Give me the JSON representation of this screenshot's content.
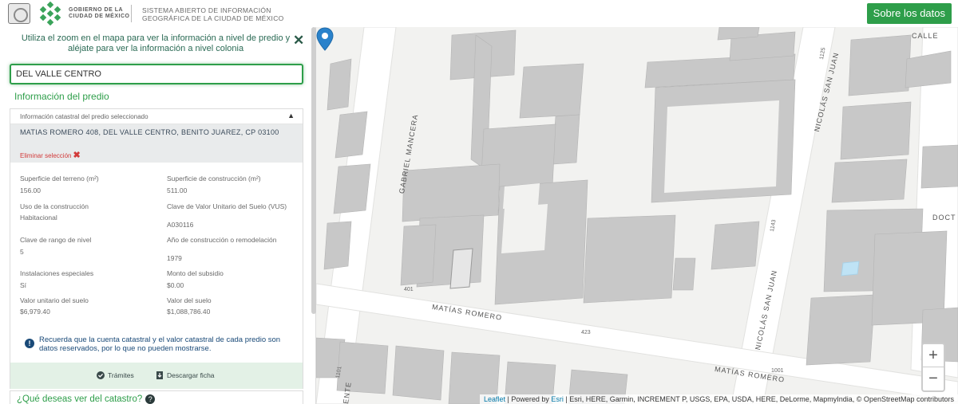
{
  "header": {
    "gov_line1": "GOBIERNO DE LA",
    "gov_line2": "CIUDAD DE MÉXICO",
    "system_line1": "SISTEMA ABIERTO DE INFORMACIÓN",
    "system_line2": "GEOGRÁFICA DE LA CIUDAD DE MÉXICO",
    "about_button": "Sobre los datos"
  },
  "panel": {
    "hint": "Utiliza el zoom en el mapa para ver la información a nivel de predio y aléjate para ver la información a nivel colonia",
    "search_value": "DEL VALLE CENTRO",
    "info_title": "Información del predio",
    "card_title": "Información catastral del predio seleccionado",
    "address": "MATIAS ROMERO 408, DEL VALLE CENTRO, BENITO JUAREZ, CP 03100",
    "remove_label": "Eliminar selección",
    "fields": {
      "superficie_terreno_label": "Superficie del terreno (m²)",
      "superficie_terreno_value": "156.00",
      "superficie_construccion_label": "Superficie de construcción (m²)",
      "superficie_construccion_value": "511.00",
      "uso_label": "Uso de la construcción",
      "uso_value": "Habitacional",
      "clave_vus_label": "Clave de Valor Unitario del Suelo (VUS)",
      "clave_vus_value": "A030116",
      "rango_nivel_label": "Clave de rango de nivel",
      "rango_nivel_value": "5",
      "anio_label": "Año de construcción o remodelación",
      "anio_value": "1979",
      "instalaciones_label": "Instalaciones especiales",
      "instalaciones_value": "Sí",
      "subsidio_label": "Monto del subsidio",
      "subsidio_value": "$0.00",
      "valor_unitario_label": "Valor unitario del suelo",
      "valor_unitario_value": "$6,979.40",
      "valor_suelo_label": "Valor del suelo",
      "valor_suelo_value": "$1,088,786.40"
    },
    "note": "Recuerda que la cuenta catastral y el valor catastral de cada predio son datos reservados, por lo que no pueden mostrarse.",
    "action_tramites": "Trámites",
    "action_descargar": "Descargar ficha",
    "ask": "¿Qué deseas ver del catastro?"
  },
  "map": {
    "streets": {
      "calle": "CALLE",
      "gabriel_mancera": "GABRIEL MANCERA",
      "nicolas_san_juan_1": "NICOLÁS SAN JUAN",
      "nicolas_san_juan_2": "NICOLÁS SAN JUAN",
      "doct": "DOCT",
      "matias_romero_1": "MATÍAS ROMERO",
      "matias_romero_2": "MATÍAS ROMERO",
      "ente": "ENTE"
    },
    "numbers": {
      "n1125": "1125",
      "n1143": "1143",
      "n401": "401",
      "n423": "423",
      "n1001": "1001",
      "n1101": "1101"
    },
    "zoom_in": "+",
    "zoom_out": "−",
    "attribution_leaflet": "Leaflet",
    "attribution_powered": " | Powered by ",
    "attribution_esri": "Esri",
    "attribution_rest": " | Esri, HERE, Garmin, INCREMENT P, USGS, EPA, USDA, HERE, DeLorme, MapmyIndia, © OpenStreetMap contributors"
  },
  "colors": {
    "brand_green": "#2e9e4a",
    "building_gray": "#c8c8c8",
    "selected_parcel": "#e6e6e6",
    "pool_blue": "#bfe3f5",
    "pin_blue": "#2a82cb"
  },
  "icons": [
    "cdmx-logo-icon",
    "shield-icon",
    "close-icon",
    "chevron-up-icon",
    "remove-x-icon",
    "info-icon",
    "check-circle-icon",
    "download-icon",
    "question-icon",
    "map-pin-icon",
    "zoom-in-icon",
    "zoom-out-icon"
  ]
}
